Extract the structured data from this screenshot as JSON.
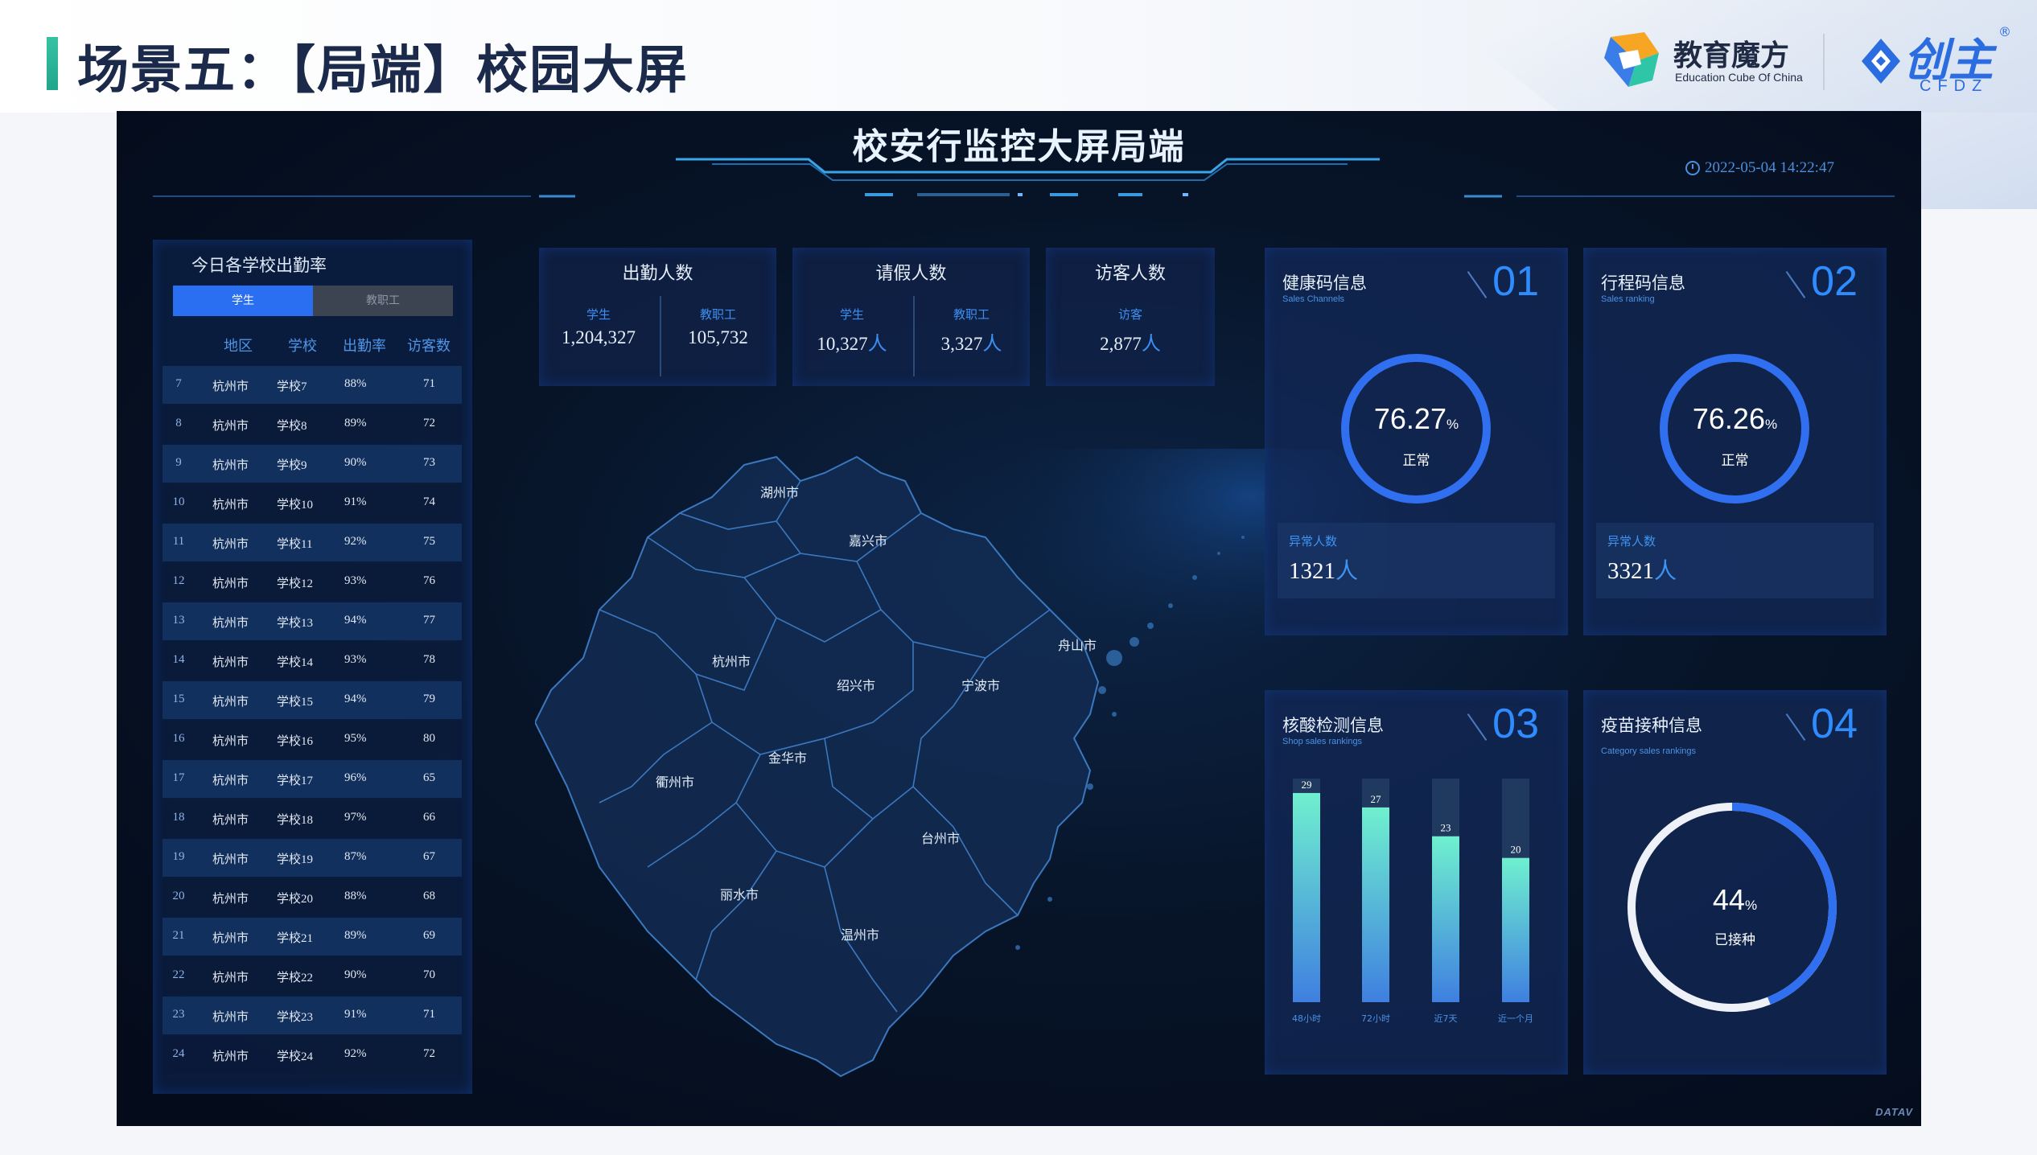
{
  "slide": {
    "title": "场景五：【局端】校园大屏",
    "logo1_name": "教育魔方",
    "logo1_sub": "Education Cube Of China",
    "logo2_name": "创主",
    "logo2_sub": "CFDZ",
    "logo2_mark": "®"
  },
  "dashboard": {
    "title": "校安行监控大屏局端",
    "datetime": "2022-05-04 14:22:47",
    "brand_mark": "DATAV"
  },
  "attendance": {
    "title": "今日各学校出勤率",
    "tabs": [
      "学生",
      "教职工"
    ],
    "active_tab": "学生",
    "columns": [
      "地区",
      "学校",
      "出勤率",
      "访客数"
    ],
    "rows": [
      {
        "idx": "7",
        "region": "杭州市",
        "school": "学校7",
        "rate": "88%",
        "visitors": "71"
      },
      {
        "idx": "8",
        "region": "杭州市",
        "school": "学校8",
        "rate": "89%",
        "visitors": "72"
      },
      {
        "idx": "9",
        "region": "杭州市",
        "school": "学校9",
        "rate": "90%",
        "visitors": "73"
      },
      {
        "idx": "10",
        "region": "杭州市",
        "school": "学校10",
        "rate": "91%",
        "visitors": "74"
      },
      {
        "idx": "11",
        "region": "杭州市",
        "school": "学校11",
        "rate": "92%",
        "visitors": "75"
      },
      {
        "idx": "12",
        "region": "杭州市",
        "school": "学校12",
        "rate": "93%",
        "visitors": "76"
      },
      {
        "idx": "13",
        "region": "杭州市",
        "school": "学校13",
        "rate": "94%",
        "visitors": "77"
      },
      {
        "idx": "14",
        "region": "杭州市",
        "school": "学校14",
        "rate": "93%",
        "visitors": "78"
      },
      {
        "idx": "15",
        "region": "杭州市",
        "school": "学校15",
        "rate": "94%",
        "visitors": "79"
      },
      {
        "idx": "16",
        "region": "杭州市",
        "school": "学校16",
        "rate": "95%",
        "visitors": "80"
      },
      {
        "idx": "17",
        "region": "杭州市",
        "school": "学校17",
        "rate": "96%",
        "visitors": "65"
      },
      {
        "idx": "18",
        "region": "杭州市",
        "school": "学校18",
        "rate": "97%",
        "visitors": "66"
      },
      {
        "idx": "19",
        "region": "杭州市",
        "school": "学校19",
        "rate": "87%",
        "visitors": "67"
      },
      {
        "idx": "20",
        "region": "杭州市",
        "school": "学校20",
        "rate": "88%",
        "visitors": "68"
      },
      {
        "idx": "21",
        "region": "杭州市",
        "school": "学校21",
        "rate": "89%",
        "visitors": "69"
      },
      {
        "idx": "22",
        "region": "杭州市",
        "school": "学校22",
        "rate": "90%",
        "visitors": "70"
      },
      {
        "idx": "23",
        "region": "杭州市",
        "school": "学校23",
        "rate": "91%",
        "visitors": "71"
      },
      {
        "idx": "24",
        "region": "杭州市",
        "school": "学校24",
        "rate": "92%",
        "visitors": "72"
      }
    ]
  },
  "stats": {
    "attendance": {
      "title": "出勤人数",
      "student_label": "学生",
      "student_value": "1,204,327",
      "staff_label": "教职工",
      "staff_value": "105,732"
    },
    "leave": {
      "title": "请假人数",
      "student_label": "学生",
      "student_value": "10,327",
      "staff_label": "教职工",
      "staff_value": "3,327",
      "unit": "人"
    },
    "visitor": {
      "title": "访客人数",
      "label": "访客",
      "value": "2,877",
      "unit": "人"
    }
  },
  "map": {
    "cities": [
      "湖州市",
      "嘉兴市",
      "杭州市",
      "绍兴市",
      "宁波市",
      "舟山市",
      "金华市",
      "衢州市",
      "台州市",
      "丽水市",
      "温州市"
    ]
  },
  "cards": {
    "health": {
      "title": "健康码信息",
      "subtitle": "Sales Channels",
      "num": "01",
      "percent": "76.27",
      "percent_value": 76.27,
      "pct_sign": "%",
      "status": "正常",
      "abn_label": "异常人数",
      "abn_value": "1321",
      "unit": "人"
    },
    "travel": {
      "title": "行程码信息",
      "subtitle": "Sales ranking",
      "num": "02",
      "percent": "76.26",
      "percent_value": 76.26,
      "pct_sign": "%",
      "status": "正常",
      "abn_label": "异常人数",
      "abn_value": "3321",
      "unit": "人"
    },
    "nucleic": {
      "title": "核酸检测信息",
      "subtitle": "Shop sales rankings",
      "num": "03"
    },
    "vaccine": {
      "title": "疫苗接种信息",
      "subtitle": "Category sales rankings",
      "num": "04",
      "percent": "44",
      "percent_value": 44,
      "pct_sign": "%",
      "status": "已接种"
    }
  },
  "chart_data": {
    "type": "bar",
    "categories": [
      "48小时",
      "72小时",
      "近7天",
      "近一个月"
    ],
    "values": [
      29,
      27,
      23,
      20
    ],
    "ylim": [
      0,
      31
    ],
    "colors": {
      "bar_top": "#6ff0cf",
      "bar_bottom": "#3f7fe0",
      "track": "#1f3a5e"
    }
  }
}
